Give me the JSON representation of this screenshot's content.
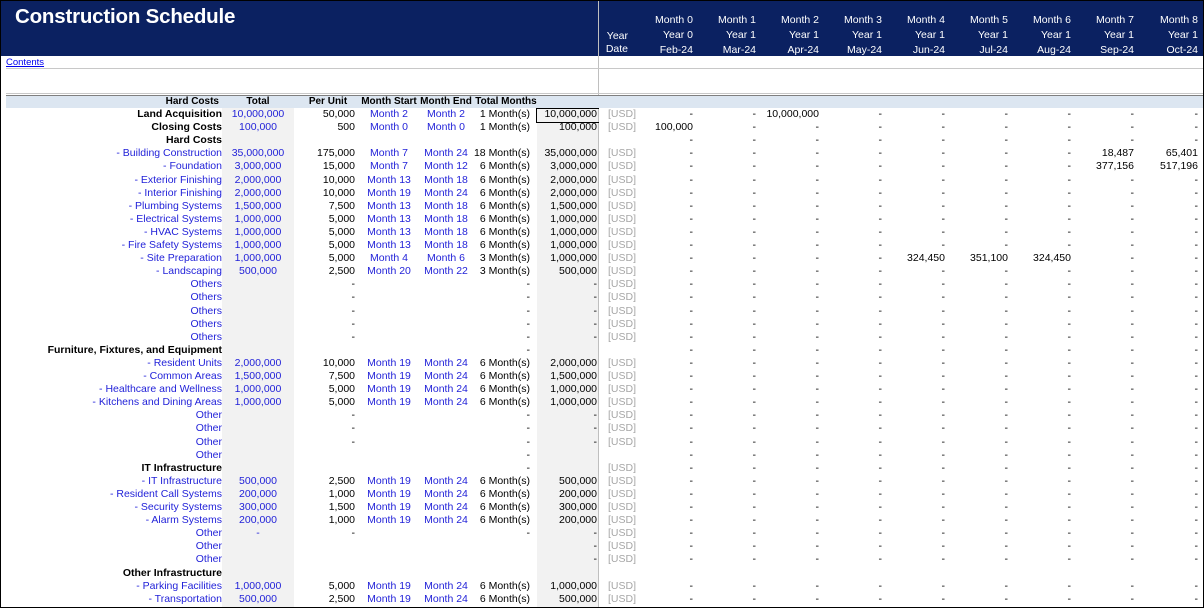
{
  "title": "Construction Schedule",
  "contents_link": "Contents",
  "header": {
    "left_label_year": "Year",
    "left_label_date": "Date",
    "months": [
      {
        "month": "Month 0",
        "year": "Year 0",
        "date": "Feb-24"
      },
      {
        "month": "Month 1",
        "year": "Year 1",
        "date": "Mar-24"
      },
      {
        "month": "Month 2",
        "year": "Year 1",
        "date": "Apr-24"
      },
      {
        "month": "Month 3",
        "year": "Year 1",
        "date": "May-24"
      },
      {
        "month": "Month 4",
        "year": "Year 1",
        "date": "Jun-24"
      },
      {
        "month": "Month 5",
        "year": "Year 1",
        "date": "Jul-24"
      },
      {
        "month": "Month 6",
        "year": "Year 1",
        "date": "Aug-24"
      },
      {
        "month": "Month 7",
        "year": "Year 1",
        "date": "Sep-24"
      },
      {
        "month": "Month 8",
        "year": "Year 1",
        "date": "Oct-24"
      }
    ]
  },
  "columns": {
    "label": "Hard Costs",
    "total": "Total",
    "per_unit": "Per Unit",
    "month_start": "Month Start",
    "month_end": "Month End",
    "total_months": "Total Months"
  },
  "rows": [
    {
      "label": "Land Acquisition",
      "style": "bold",
      "total": "10,000,000",
      "per_unit": "50,000",
      "start": "Month 2",
      "end": "Month 2",
      "months": "1 Month(s)",
      "sum": "10,000,000",
      "usd": "[USD]",
      "vals": [
        "-",
        "-",
        "10,000,000",
        "-",
        "-",
        "-",
        "-",
        "-",
        "-"
      ]
    },
    {
      "label": "Closing Costs",
      "style": "bold",
      "total": "100,000",
      "per_unit": "500",
      "start": "Month 0",
      "end": "Month 0",
      "months": "1 Month(s)",
      "sum": "100,000",
      "usd": "[USD]",
      "vals": [
        "100,000",
        "-",
        "-",
        "-",
        "-",
        "-",
        "-",
        "-",
        "-"
      ]
    },
    {
      "label": "Hard Costs",
      "style": "bold",
      "total": "",
      "per_unit": "",
      "start": "",
      "end": "",
      "months": "",
      "sum": "",
      "usd": "",
      "vals": [
        "-",
        "-",
        "-",
        "-",
        "-",
        "-",
        "-",
        "-",
        "-"
      ]
    },
    {
      "label": "- Building Construction",
      "style": "item",
      "total": "35,000,000",
      "per_unit": "175,000",
      "start": "Month 7",
      "end": "Month 24",
      "months": "18 Month(s)",
      "sum": "35,000,000",
      "usd": "[USD]",
      "vals": [
        "-",
        "-",
        "-",
        "-",
        "-",
        "-",
        "-",
        "18,487",
        "65,401"
      ]
    },
    {
      "label": "- Foundation",
      "style": "item",
      "total": "3,000,000",
      "per_unit": "15,000",
      "start": "Month 7",
      "end": "Month 12",
      "months": "6 Month(s)",
      "sum": "3,000,000",
      "usd": "[USD]",
      "vals": [
        "-",
        "-",
        "-",
        "-",
        "-",
        "-",
        "-",
        "377,156",
        "517,196"
      ]
    },
    {
      "label": "- Exterior Finishing",
      "style": "item",
      "total": "2,000,000",
      "per_unit": "10,000",
      "start": "Month 13",
      "end": "Month 18",
      "months": "6 Month(s)",
      "sum": "2,000,000",
      "usd": "[USD]",
      "vals": [
        "-",
        "-",
        "-",
        "-",
        "-",
        "-",
        "-",
        "-",
        "-"
      ]
    },
    {
      "label": "- Interior Finishing",
      "style": "item",
      "total": "2,000,000",
      "per_unit": "10,000",
      "start": "Month 19",
      "end": "Month 24",
      "months": "6 Month(s)",
      "sum": "2,000,000",
      "usd": "[USD]",
      "vals": [
        "-",
        "-",
        "-",
        "-",
        "-",
        "-",
        "-",
        "-",
        "-"
      ]
    },
    {
      "label": "- Plumbing Systems",
      "style": "item",
      "total": "1,500,000",
      "per_unit": "7,500",
      "start": "Month 13",
      "end": "Month 18",
      "months": "6 Month(s)",
      "sum": "1,500,000",
      "usd": "[USD]",
      "vals": [
        "-",
        "-",
        "-",
        "-",
        "-",
        "-",
        "-",
        "-",
        "-"
      ]
    },
    {
      "label": "- Electrical Systems",
      "style": "item",
      "total": "1,000,000",
      "per_unit": "5,000",
      "start": "Month 13",
      "end": "Month 18",
      "months": "6 Month(s)",
      "sum": "1,000,000",
      "usd": "[USD]",
      "vals": [
        "-",
        "-",
        "-",
        "-",
        "-",
        "-",
        "-",
        "-",
        "-"
      ]
    },
    {
      "label": "- HVAC Systems",
      "style": "item",
      "total": "1,000,000",
      "per_unit": "5,000",
      "start": "Month 13",
      "end": "Month 18",
      "months": "6 Month(s)",
      "sum": "1,000,000",
      "usd": "[USD]",
      "vals": [
        "-",
        "-",
        "-",
        "-",
        "-",
        "-",
        "-",
        "-",
        "-"
      ]
    },
    {
      "label": "- Fire Safety Systems",
      "style": "item",
      "total": "1,000,000",
      "per_unit": "5,000",
      "start": "Month 13",
      "end": "Month 18",
      "months": "6 Month(s)",
      "sum": "1,000,000",
      "usd": "[USD]",
      "vals": [
        "-",
        "-",
        "-",
        "-",
        "-",
        "-",
        "-",
        "-",
        "-"
      ]
    },
    {
      "label": "- Site Preparation",
      "style": "item",
      "total": "1,000,000",
      "per_unit": "5,000",
      "start": "Month 4",
      "end": "Month 6",
      "months": "3 Month(s)",
      "sum": "1,000,000",
      "usd": "[USD]",
      "vals": [
        "-",
        "-",
        "-",
        "-",
        "324,450",
        "351,100",
        "324,450",
        "-",
        "-"
      ]
    },
    {
      "label": "- Landscaping",
      "style": "item",
      "total": "500,000",
      "per_unit": "2,500",
      "start": "Month 20",
      "end": "Month 22",
      "months": "3 Month(s)",
      "sum": "500,000",
      "usd": "[USD]",
      "vals": [
        "-",
        "-",
        "-",
        "-",
        "-",
        "-",
        "-",
        "-",
        "-"
      ]
    },
    {
      "label": "Others",
      "style": "item",
      "total": "",
      "per_unit": "-",
      "start": "",
      "end": "",
      "months": "-",
      "sum": "-",
      "usd": "[USD]",
      "vals": [
        "-",
        "-",
        "-",
        "-",
        "-",
        "-",
        "-",
        "-",
        "-"
      ]
    },
    {
      "label": "Others",
      "style": "item",
      "total": "",
      "per_unit": "-",
      "start": "",
      "end": "",
      "months": "-",
      "sum": "-",
      "usd": "[USD]",
      "vals": [
        "-",
        "-",
        "-",
        "-",
        "-",
        "-",
        "-",
        "-",
        "-"
      ]
    },
    {
      "label": "Others",
      "style": "item",
      "total": "",
      "per_unit": "-",
      "start": "",
      "end": "",
      "months": "-",
      "sum": "-",
      "usd": "[USD]",
      "vals": [
        "-",
        "-",
        "-",
        "-",
        "-",
        "-",
        "-",
        "-",
        "-"
      ]
    },
    {
      "label": "Others",
      "style": "item",
      "total": "",
      "per_unit": "-",
      "start": "",
      "end": "",
      "months": "-",
      "sum": "-",
      "usd": "[USD]",
      "vals": [
        "-",
        "-",
        "-",
        "-",
        "-",
        "-",
        "-",
        "-",
        "-"
      ]
    },
    {
      "label": "Others",
      "style": "item",
      "total": "",
      "per_unit": "-",
      "start": "",
      "end": "",
      "months": "-",
      "sum": "-",
      "usd": "[USD]",
      "vals": [
        "-",
        "-",
        "-",
        "-",
        "-",
        "-",
        "-",
        "-",
        "-"
      ]
    },
    {
      "label": "Furniture, Fixtures, and Equipment",
      "style": "bold",
      "total": "",
      "per_unit": "",
      "start": "",
      "end": "",
      "months": "-",
      "sum": "",
      "usd": "",
      "vals": [
        "-",
        "-",
        "-",
        "-",
        "-",
        "-",
        "-",
        "-",
        "-"
      ]
    },
    {
      "label": "- Resident Units",
      "style": "item",
      "total": "2,000,000",
      "per_unit": "10,000",
      "start": "Month 19",
      "end": "Month 24",
      "months": "6 Month(s)",
      "sum": "2,000,000",
      "usd": "[USD]",
      "vals": [
        "-",
        "-",
        "-",
        "-",
        "-",
        "-",
        "-",
        "-",
        "-"
      ]
    },
    {
      "label": "- Common Areas",
      "style": "item",
      "total": "1,500,000",
      "per_unit": "7,500",
      "start": "Month 19",
      "end": "Month 24",
      "months": "6 Month(s)",
      "sum": "1,500,000",
      "usd": "[USD]",
      "vals": [
        "-",
        "-",
        "-",
        "-",
        "-",
        "-",
        "-",
        "-",
        "-"
      ]
    },
    {
      "label": "- Healthcare and Wellness",
      "style": "item",
      "total": "1,000,000",
      "per_unit": "5,000",
      "start": "Month 19",
      "end": "Month 24",
      "months": "6 Month(s)",
      "sum": "1,000,000",
      "usd": "[USD]",
      "vals": [
        "-",
        "-",
        "-",
        "-",
        "-",
        "-",
        "-",
        "-",
        "-"
      ]
    },
    {
      "label": "- Kitchens and Dining Areas",
      "style": "item",
      "total": "1,000,000",
      "per_unit": "5,000",
      "start": "Month 19",
      "end": "Month 24",
      "months": "6 Month(s)",
      "sum": "1,000,000",
      "usd": "[USD]",
      "vals": [
        "-",
        "-",
        "-",
        "-",
        "-",
        "-",
        "-",
        "-",
        "-"
      ]
    },
    {
      "label": "Other",
      "style": "item",
      "total": "",
      "per_unit": "-",
      "start": "",
      "end": "",
      "months": "-",
      "sum": "-",
      "usd": "[USD]",
      "vals": [
        "-",
        "-",
        "-",
        "-",
        "-",
        "-",
        "-",
        "-",
        "-"
      ]
    },
    {
      "label": "Other",
      "style": "item",
      "total": "",
      "per_unit": "-",
      "start": "",
      "end": "",
      "months": "-",
      "sum": "-",
      "usd": "[USD]",
      "vals": [
        "-",
        "-",
        "-",
        "-",
        "-",
        "-",
        "-",
        "-",
        "-"
      ]
    },
    {
      "label": "Other",
      "style": "item",
      "total": "",
      "per_unit": "-",
      "start": "",
      "end": "",
      "months": "-",
      "sum": "-",
      "usd": "[USD]",
      "vals": [
        "-",
        "-",
        "-",
        "-",
        "-",
        "-",
        "-",
        "-",
        "-"
      ]
    },
    {
      "label": "Other",
      "style": "item",
      "total": "",
      "per_unit": "",
      "start": "",
      "end": "",
      "months": "-",
      "sum": "",
      "usd": "",
      "vals": [
        "-",
        "-",
        "-",
        "-",
        "-",
        "-",
        "-",
        "-",
        "-"
      ]
    },
    {
      "label": "IT Infrastructure",
      "style": "bold",
      "total": "",
      "per_unit": "",
      "start": "",
      "end": "",
      "months": "-",
      "sum": "",
      "usd": "[USD]",
      "vals": [
        "-",
        "-",
        "-",
        "-",
        "-",
        "-",
        "-",
        "-",
        "-"
      ]
    },
    {
      "label": "- IT Infrastructure",
      "style": "item",
      "total": "500,000",
      "per_unit": "2,500",
      "start": "Month 19",
      "end": "Month 24",
      "months": "6 Month(s)",
      "sum": "500,000",
      "usd": "[USD]",
      "vals": [
        "-",
        "-",
        "-",
        "-",
        "-",
        "-",
        "-",
        "-",
        "-"
      ]
    },
    {
      "label": "- Resident Call Systems",
      "style": "item",
      "total": "200,000",
      "per_unit": "1,000",
      "start": "Month 19",
      "end": "Month 24",
      "months": "6 Month(s)",
      "sum": "200,000",
      "usd": "[USD]",
      "vals": [
        "-",
        "-",
        "-",
        "-",
        "-",
        "-",
        "-",
        "-",
        "-"
      ]
    },
    {
      "label": "- Security Systems",
      "style": "item",
      "total": "300,000",
      "per_unit": "1,500",
      "start": "Month 19",
      "end": "Month 24",
      "months": "6 Month(s)",
      "sum": "300,000",
      "usd": "[USD]",
      "vals": [
        "-",
        "-",
        "-",
        "-",
        "-",
        "-",
        "-",
        "-",
        "-"
      ]
    },
    {
      "label": "- Alarm Systems",
      "style": "item",
      "total": "200,000",
      "per_unit": "1,000",
      "start": "Month 19",
      "end": "Month 24",
      "months": "6 Month(s)",
      "sum": "200,000",
      "usd": "[USD]",
      "vals": [
        "-",
        "-",
        "-",
        "-",
        "-",
        "-",
        "-",
        "-",
        "-"
      ]
    },
    {
      "label": "Other",
      "style": "item",
      "total": "-",
      "per_unit": "-",
      "start": "",
      "end": "",
      "months": "-",
      "sum": "-",
      "usd": "[USD]",
      "vals": [
        "-",
        "-",
        "-",
        "-",
        "-",
        "-",
        "-",
        "-",
        "-"
      ]
    },
    {
      "label": "Other",
      "style": "item",
      "total": "",
      "per_unit": "",
      "start": "",
      "end": "",
      "months": "",
      "sum": "-",
      "usd": "[USD]",
      "vals": [
        "-",
        "-",
        "-",
        "-",
        "-",
        "-",
        "-",
        "-",
        "-"
      ]
    },
    {
      "label": "Other",
      "style": "item",
      "total": "",
      "per_unit": "",
      "start": "",
      "end": "",
      "months": "",
      "sum": "-",
      "usd": "[USD]",
      "vals": [
        "-",
        "-",
        "-",
        "-",
        "-",
        "-",
        "-",
        "-",
        "-"
      ]
    },
    {
      "label": "Other Infrastructure",
      "style": "bold",
      "total": "",
      "per_unit": "",
      "start": "",
      "end": "",
      "months": "",
      "sum": "",
      "usd": "",
      "vals": [
        "",
        "",
        "",
        "",
        "",
        "",
        "",
        "",
        ""
      ]
    },
    {
      "label": "- Parking Facilities",
      "style": "item",
      "total": "1,000,000",
      "per_unit": "5,000",
      "start": "Month 19",
      "end": "Month 24",
      "months": "6 Month(s)",
      "sum": "1,000,000",
      "usd": "[USD]",
      "vals": [
        "-",
        "-",
        "-",
        "-",
        "-",
        "-",
        "-",
        "-",
        "-"
      ]
    },
    {
      "label": "- Transportation",
      "style": "item",
      "total": "500,000",
      "per_unit": "2,500",
      "start": "Month 19",
      "end": "Month 24",
      "months": "6 Month(s)",
      "sum": "500,000",
      "usd": "[USD]",
      "vals": [
        "-",
        "-",
        "-",
        "-",
        "-",
        "-",
        "-",
        "-",
        "-"
      ]
    }
  ]
}
